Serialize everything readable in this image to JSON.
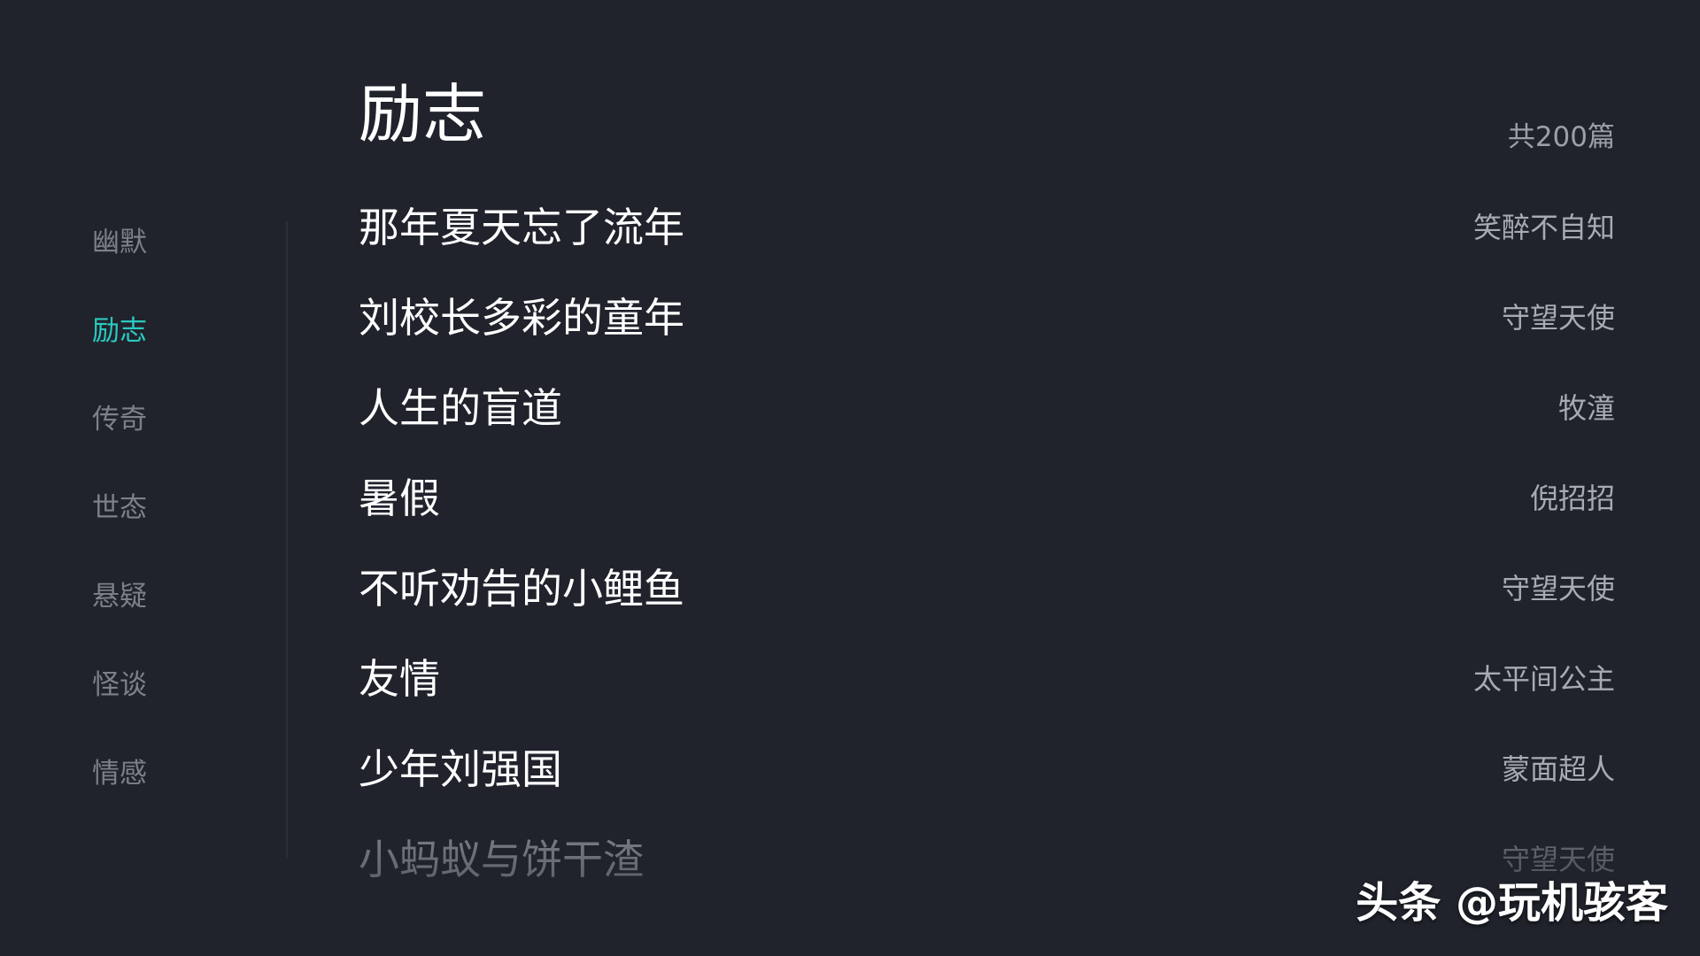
{
  "theme": {
    "background": "#20232c",
    "accent": "#2bc9c1",
    "inactive_text": "#7c808a",
    "primary_text": "#ffffff",
    "secondary_text": "#a6abb4"
  },
  "sidebar": {
    "items": [
      {
        "label": "幽默",
        "active": false
      },
      {
        "label": "励志",
        "active": true
      },
      {
        "label": "传奇",
        "active": false
      },
      {
        "label": "世态",
        "active": false
      },
      {
        "label": "悬疑",
        "active": false
      },
      {
        "label": "怪谈",
        "active": false
      },
      {
        "label": "情感",
        "active": false
      }
    ]
  },
  "header": {
    "title": "励志",
    "total": "共200篇"
  },
  "stories": [
    {
      "title": "那年夏天忘了流年",
      "author": "笑醉不自知"
    },
    {
      "title": "刘校长多彩的童年",
      "author": "守望天使"
    },
    {
      "title": "人生的盲道",
      "author": "牧潼"
    },
    {
      "title": "暑假",
      "author": "倪招招"
    },
    {
      "title": "不听劝告的小鲤鱼",
      "author": "守望天使"
    },
    {
      "title": "友情",
      "author": "太平间公主"
    },
    {
      "title": "少年刘强国",
      "author": "蒙面超人"
    },
    {
      "title": "小蚂蚁与饼干渣",
      "author": "守望天使"
    }
  ],
  "watermark": "头条 @玩机骇客"
}
